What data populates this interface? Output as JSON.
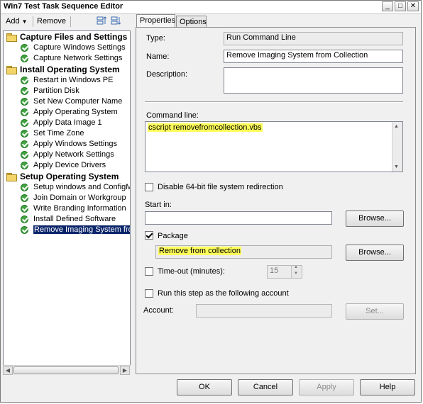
{
  "window": {
    "title": "Win7 Test Task Sequence Editor"
  },
  "titlebar_buttons": [
    "_",
    "□",
    "✕"
  ],
  "toolbar": {
    "add_label": "Add",
    "remove_label": "Remove"
  },
  "tree": {
    "groups": [
      {
        "label": "Capture Files and Settings",
        "items": [
          "Capture Windows Settings",
          "Capture Network Settings"
        ]
      },
      {
        "label": "Install Operating System",
        "items": [
          "Restart in Windows PE",
          "Partition Disk",
          "Set New Computer Name",
          "Apply Operating System",
          "Apply Data Image 1",
          "Set Time Zone",
          "Apply Windows Settings",
          "Apply Network Settings",
          "Apply Device Drivers"
        ]
      },
      {
        "label": "Setup Operating System",
        "items": [
          "Setup windows and ConfigMgr",
          "Join Domain or Workgroup",
          "Write Branding Information",
          "Install Defined Software",
          "Remove Imaging System from C"
        ]
      }
    ]
  },
  "tabs": [
    "Properties",
    "Options"
  ],
  "properties": {
    "type_label": "Type:",
    "type_value": "Run Command Line",
    "name_label": "Name:",
    "name_value": "Remove Imaging System from Collection",
    "description_label": "Description:",
    "description_value": "",
    "command_line_label": "Command line:",
    "command_line_value": "cscript removefromcollection.vbs",
    "disable_redirection_label": "Disable 64-bit file system redirection",
    "disable_redirection_checked": false,
    "start_in_label": "Start in:",
    "start_in_value": "",
    "browse_label": "Browse...",
    "package_label": "Package",
    "package_checked": true,
    "package_value": "Remove from collection",
    "browse2_label": "Browse...",
    "timeout_label": "Time-out (minutes):",
    "timeout_checked": false,
    "timeout_value": "15",
    "run_as_label": "Run this step as the following account",
    "run_as_checked": false,
    "account_label": "Account:",
    "account_value": "",
    "set_label": "Set..."
  },
  "footer": {
    "ok_label": "OK",
    "cancel_label": "Cancel",
    "apply_label": "Apply",
    "help_label": "Help"
  }
}
